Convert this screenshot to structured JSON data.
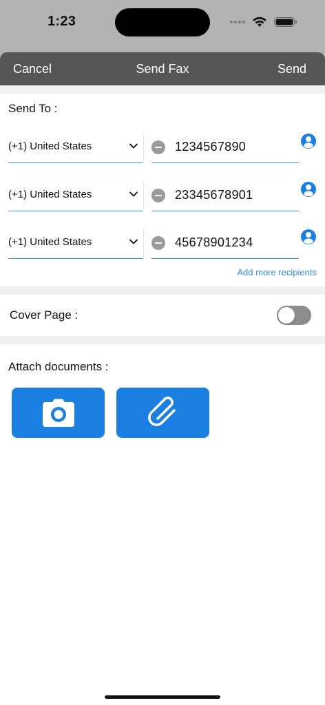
{
  "status_bar": {
    "time": "1:23"
  },
  "nav": {
    "cancel_label": "Cancel",
    "title": "Send Fax",
    "send_label": "Send"
  },
  "send_to": {
    "label": "Send To :",
    "recipients": [
      {
        "country": "(+1) United States",
        "number": "1234567890"
      },
      {
        "country": "(+1) United States",
        "number": "23345678901"
      },
      {
        "country": "(+1) United States",
        "number": "45678901234"
      }
    ],
    "add_more_label": "Add more recipients"
  },
  "cover_page": {
    "label": "Cover Page :",
    "enabled": false
  },
  "attach": {
    "label": "Attach documents :"
  },
  "icons": {
    "country_chevron": "chevron-down-icon",
    "remove_recipient": "minus-circle-icon",
    "contact": "person-circle-icon",
    "camera": "camera-icon",
    "attachment": "paperclip-icon",
    "wifi": "wifi-icon",
    "battery": "battery-icon"
  },
  "colors": {
    "accent": "#1a7fe0",
    "link": "#2f8fe0",
    "nav_bar": "#555555",
    "toggle_off": "#8c8c8c"
  }
}
